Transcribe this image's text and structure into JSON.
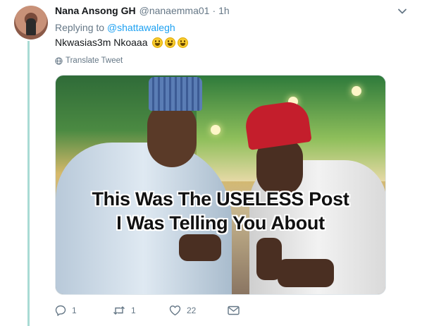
{
  "tweet": {
    "display_name": "Nana Ansong GH",
    "handle": "@nanaemma01",
    "separator": "·",
    "time": "1h",
    "replying_prefix": "Replying to",
    "replying_to": "@shattawalegh",
    "text": "Nkwasias3m Nkoaaa",
    "emojis": [
      "grinning-face-emoji",
      "grinning-face-emoji",
      "grinning-face-emoji"
    ],
    "translate_label": "Translate Tweet"
  },
  "media": {
    "caption_line1": "This Was The USELESS Post",
    "caption_line2": "I Was Telling You About"
  },
  "actions": {
    "reply_count": "1",
    "retweet_count": "1",
    "like_count": "22"
  },
  "colors": {
    "accent": "#1da1f2",
    "muted": "#657786",
    "thread_line": "#a9dbd4"
  }
}
